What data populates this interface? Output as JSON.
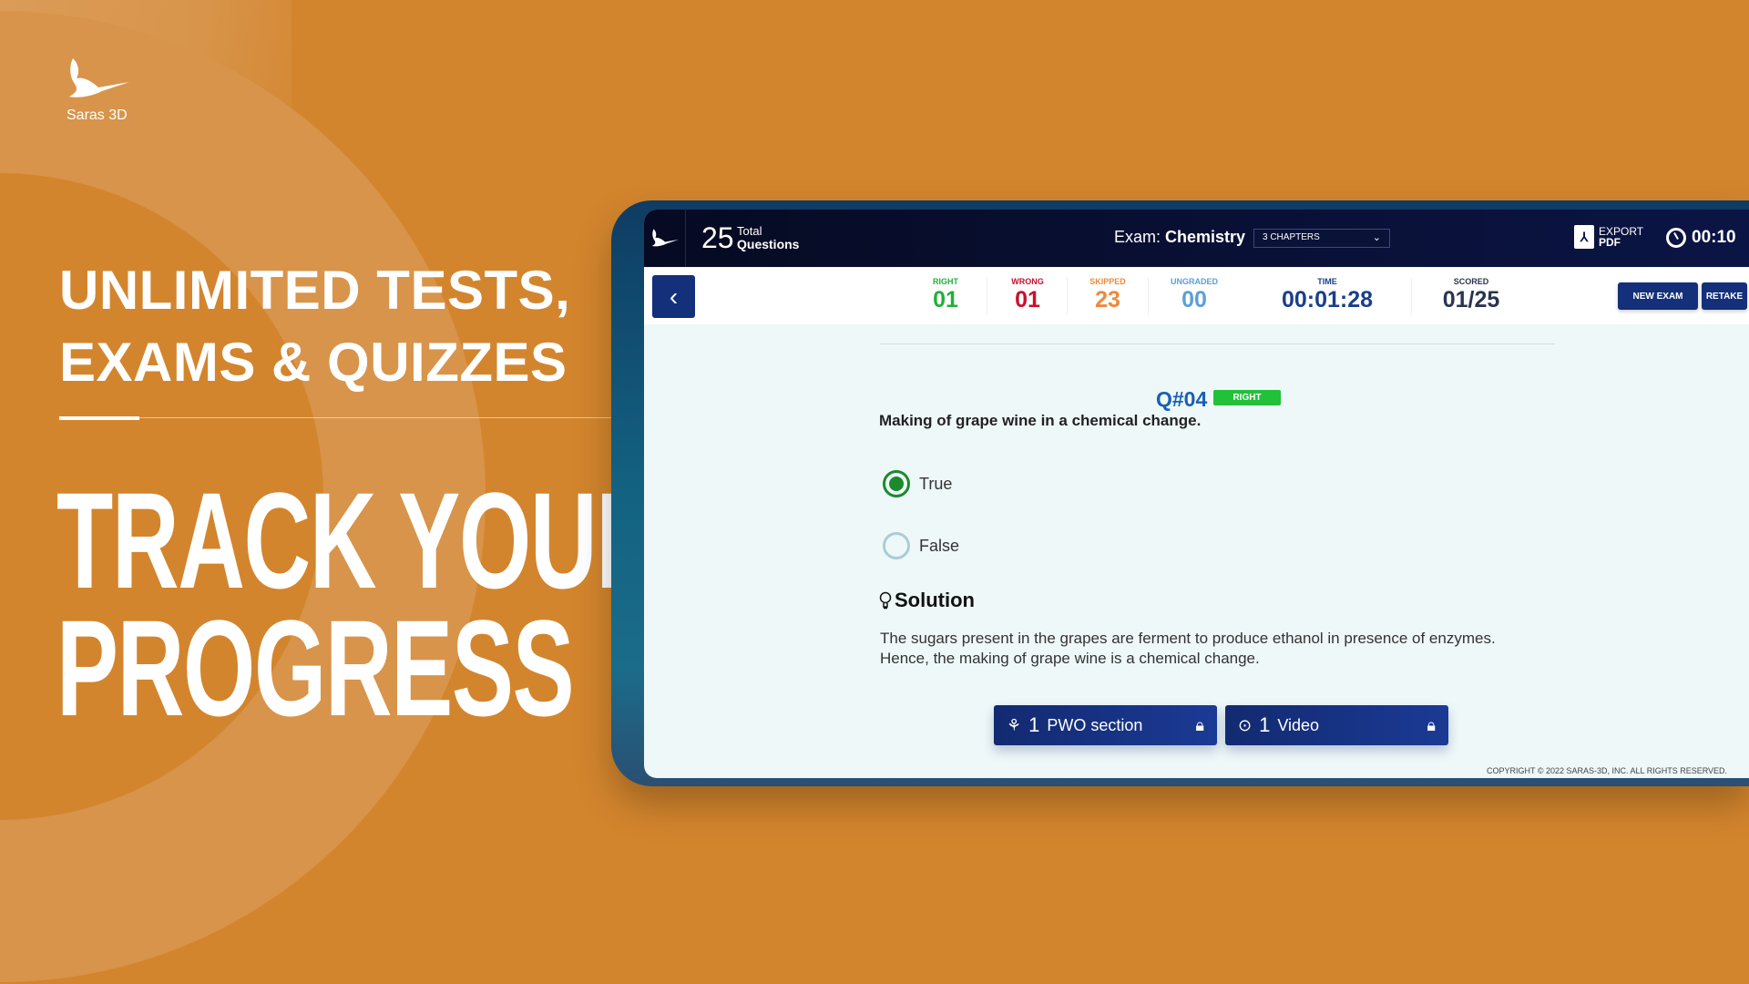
{
  "brand": {
    "name": "Saras 3D"
  },
  "headline": {
    "line1": "UNLIMITED TESTS,",
    "line2": "EXAMS & QUIZZES"
  },
  "tagline": {
    "line1": "TRACK YOUR",
    "line2": "PROGRESS"
  },
  "app": {
    "header": {
      "total_count": "25",
      "total_label_1": "Total",
      "total_label_2": "Questions",
      "exam_prefix": "Exam:",
      "exam_name": "Chemistry",
      "chapters_select": "3 CHAPTERS",
      "export_1": "EXPORT",
      "export_2": "PDF",
      "timer": "00:10"
    },
    "stats": [
      {
        "label": "RIGHT",
        "value": "01",
        "color": "#22b03a"
      },
      {
        "label": "WRONG",
        "value": "01",
        "color": "#c8102e"
      },
      {
        "label": "SKIPPED",
        "value": "23",
        "color": "#f0883a"
      },
      {
        "label": "UNGRADED",
        "value": "00",
        "color": "#5aa0d8"
      },
      {
        "label": "TIME",
        "value": "00:01:28",
        "color": "#1a3f8a"
      },
      {
        "label": "SCORED",
        "value": "01/25",
        "color": "#2a3550"
      }
    ],
    "buttons": {
      "new_exam": "NEW EXAM",
      "retake": "RETAKE"
    },
    "question": {
      "number": "Q#04",
      "status": "RIGHT",
      "text": "Making of grape wine in a chemical change.",
      "options": [
        {
          "label": "True",
          "selected": true
        },
        {
          "label": "False",
          "selected": false
        }
      ]
    },
    "solution": {
      "title": "Solution",
      "line1": "The sugars present in the grapes are ferment to produce ethanol in presence of enzymes.",
      "line2": "Hence, the making of grape wine is a chemical change."
    },
    "resources": [
      {
        "count": "1",
        "label": "PWO section",
        "icon": "model-icon",
        "locked": true
      },
      {
        "count": "1",
        "label": "Video",
        "icon": "play-icon",
        "locked": true
      }
    ],
    "copyright": "COPYRIGHT © 2022 SARAS-3D, INC. ALL RIGHTS RESERVED."
  }
}
